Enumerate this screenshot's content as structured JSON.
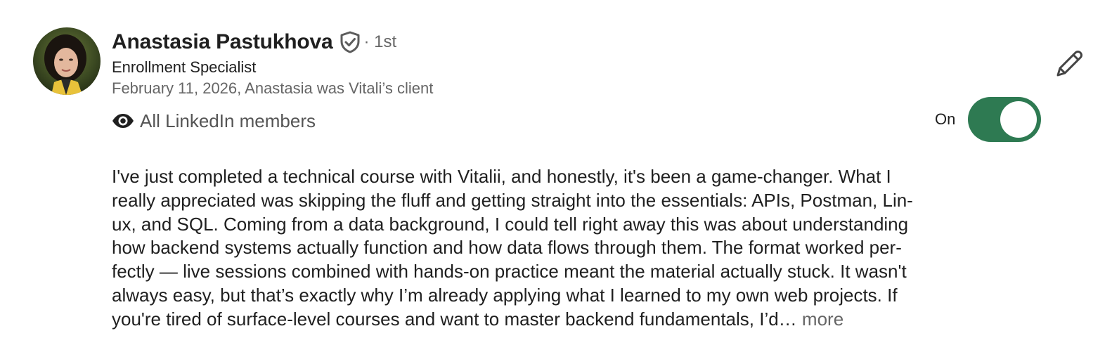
{
  "recommendation": {
    "name": "Anastasia Pastukhova",
    "degree": "· 1st",
    "headline": "Enrollment Specialist",
    "meta": "February 11, 2026, Anastasia was Vitali’s client",
    "visibility": {
      "icon": "eye-icon",
      "label": "All LinkedIn members"
    },
    "toggle": {
      "label": "On",
      "state": true,
      "color": "#2e7a52"
    },
    "text_lines": [
      "I've just completed a technical course with Vitalii, and honestly, it's been a game-changer. What I",
      "really appreciated was skipping the fluff and getting straight into the essentials: APIs, Postman, Lin-",
      "ux, and SQL. Coming from a data background, I could tell right away this was about understanding",
      "how backend systems actually function and how data flows through them. The format worked per-",
      "fectly — live sessions combined with hands-on practice meant the material actually stuck. It wasn't",
      "always easy, but that’s exactly why I’m already applying what I learned to my own web projects. If",
      "you're tired of surface-level courses and want to master backend fundamentals, I’d…"
    ],
    "more_label": "more"
  }
}
